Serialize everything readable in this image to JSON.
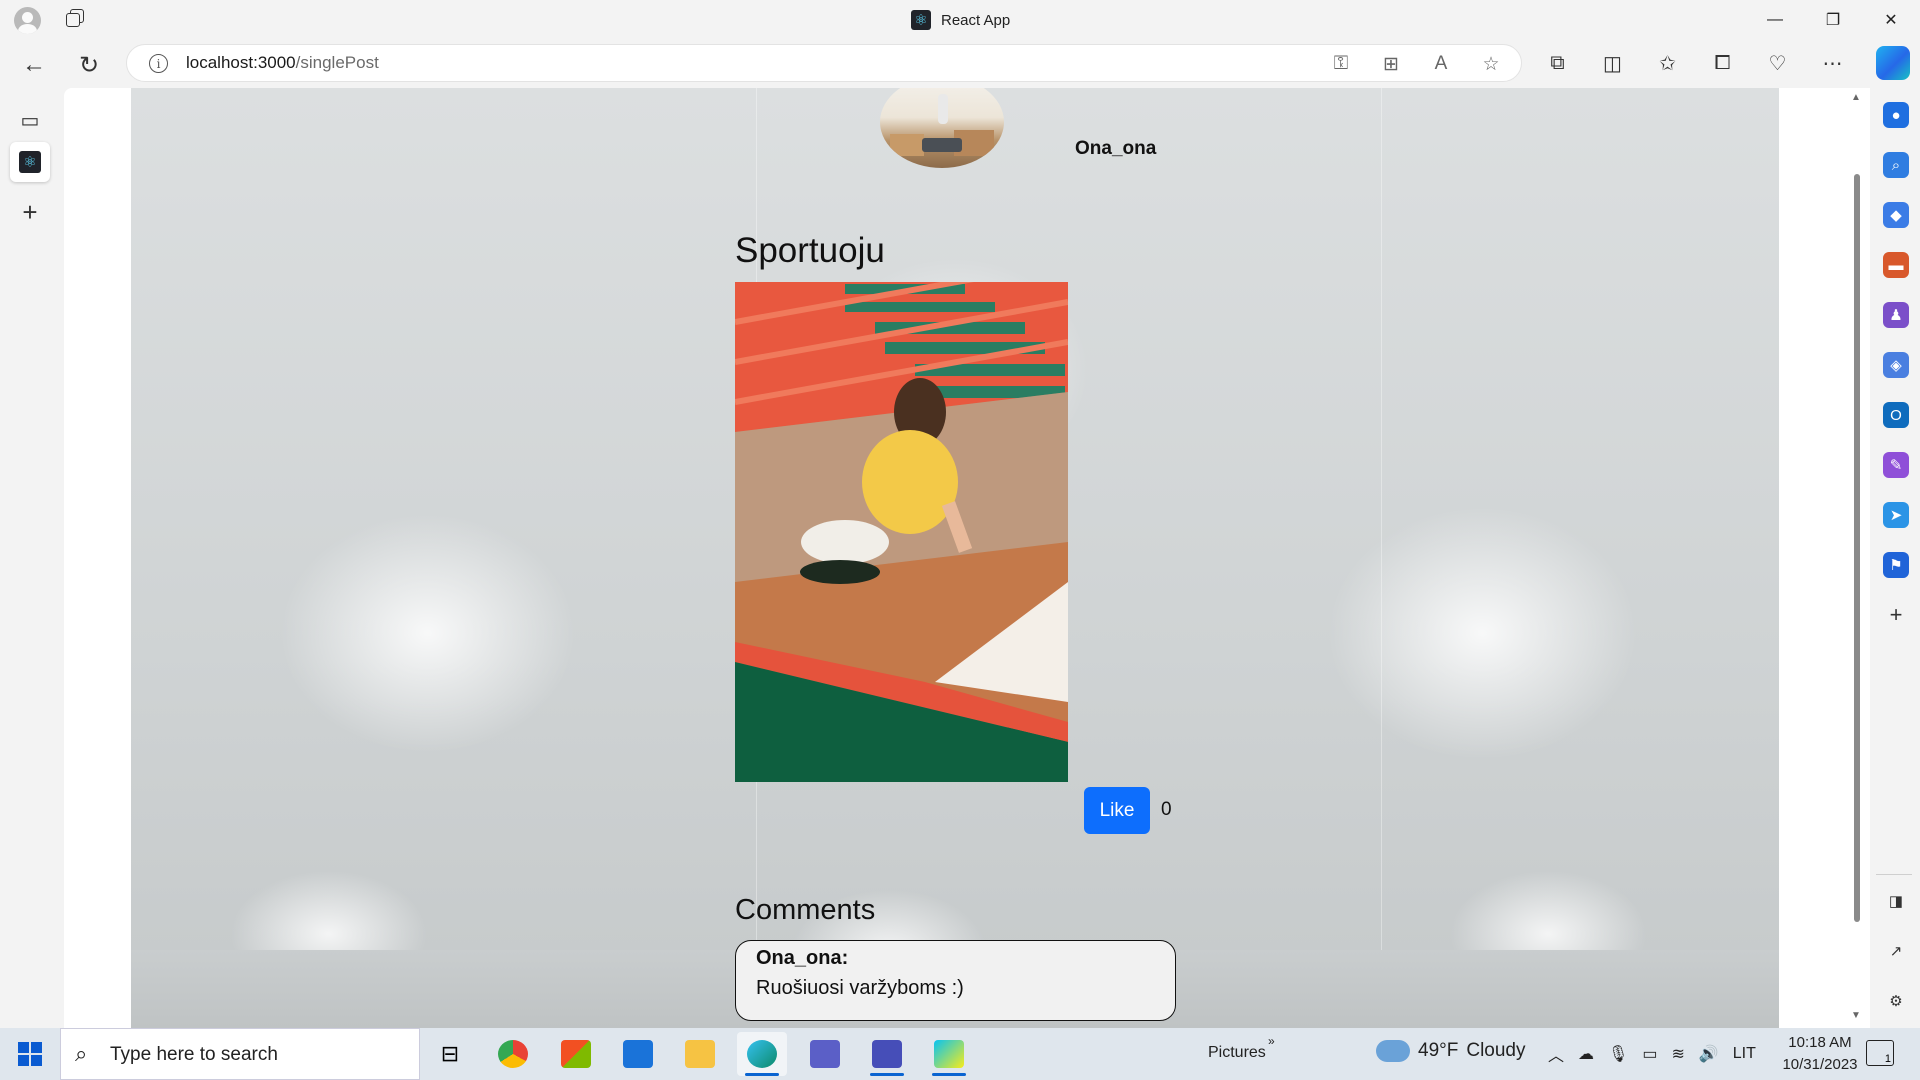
{
  "window": {
    "title": "React App",
    "minimize": "—",
    "maximize": "❐",
    "close": "✕"
  },
  "address_bar": {
    "host": "localhost:3000",
    "path": "/singlePost"
  },
  "post": {
    "username": "Ona_ona",
    "title": "Sportuoju",
    "like_label": "Like",
    "like_count": "0"
  },
  "comments": {
    "heading": "Comments",
    "items": [
      {
        "author": "Ona_ona:",
        "text": "Ruošiuosi varžyboms :)"
      }
    ]
  },
  "taskbar": {
    "search_placeholder": "Type here to search",
    "pictures_label": "Pictures",
    "weather_temp": "49°F",
    "weather_desc": "Cloudy",
    "language": "LIT",
    "time": "10:18 AM",
    "date": "10/31/2023",
    "notification_count": "1"
  },
  "colors": {
    "like_button": "#0d6efd",
    "page_background": "#d6d9da",
    "taskbar": "#dfe6ed"
  }
}
